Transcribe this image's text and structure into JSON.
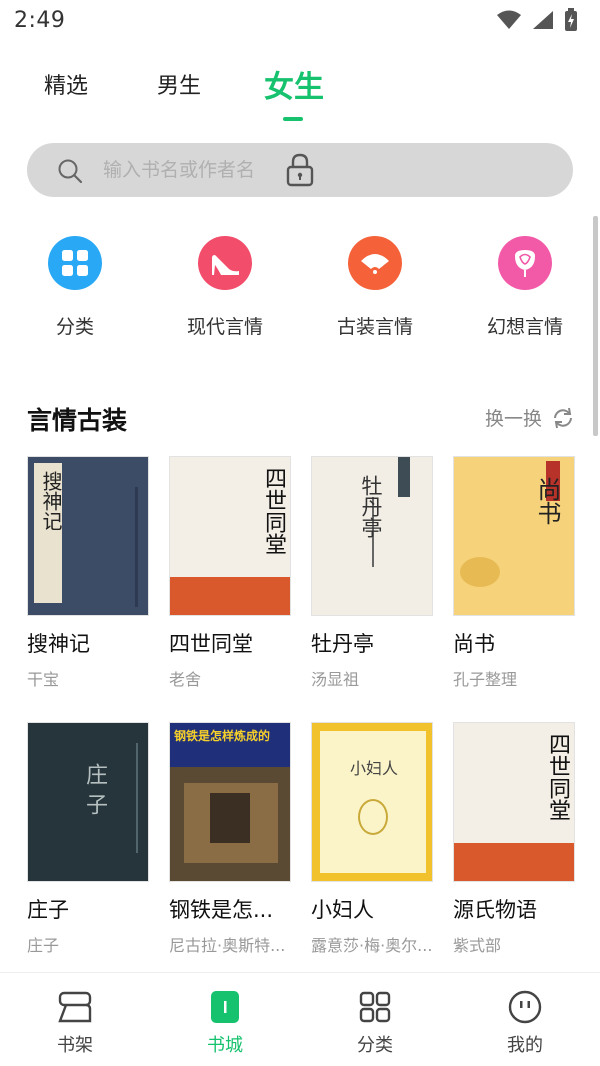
{
  "status_bar": {
    "time": "2:49"
  },
  "tabs": [
    {
      "label": "精选",
      "active": false
    },
    {
      "label": "男生",
      "active": false
    },
    {
      "label": "女生",
      "active": true
    }
  ],
  "search": {
    "placeholder": "输入书名或作者名",
    "value": ""
  },
  "categories": [
    {
      "label": "分类",
      "icon": "grid-icon",
      "color": "#29a8f5"
    },
    {
      "label": "现代言情",
      "icon": "high-heel-icon",
      "color": "#f24d6a"
    },
    {
      "label": "古装言情",
      "icon": "fan-icon",
      "color": "#f5623a"
    },
    {
      "label": "幻想言情",
      "icon": "rose-icon",
      "color": "#f25aa8"
    }
  ],
  "section": {
    "title": "言情古装",
    "refresh_label": "换一换"
  },
  "books": [
    {
      "title": "搜神记",
      "author": "干宝",
      "cover_text": "搜神记"
    },
    {
      "title": "四世同堂",
      "author": "老舍",
      "cover_text": "四世同堂"
    },
    {
      "title": "牡丹亭",
      "author": "汤显祖",
      "cover_text": "牡丹亭"
    },
    {
      "title": "尚书",
      "author": "孔子整理",
      "cover_text": "尚书"
    },
    {
      "title": "庄子",
      "author": "庄子",
      "cover_text": "庄子"
    },
    {
      "title": "钢铁是怎...",
      "author": "尼古拉·奥斯特...",
      "cover_text": "钢铁是怎样炼成的"
    },
    {
      "title": "小妇人",
      "author": "露意莎·梅·奥尔...",
      "cover_text": "小妇人"
    },
    {
      "title": "源氏物语",
      "author": "紫式部",
      "cover_text": "四世同堂"
    }
  ],
  "bottom_nav": [
    {
      "label": "书架",
      "icon": "bookshelf-icon",
      "active": false
    },
    {
      "label": "书城",
      "icon": "bookstore-icon",
      "active": true
    },
    {
      "label": "分类",
      "icon": "category-grid-icon",
      "active": false
    },
    {
      "label": "我的",
      "icon": "profile-icon",
      "active": false
    }
  ],
  "colors": {
    "accent": "#16c26e",
    "muted_text": "#999999"
  }
}
